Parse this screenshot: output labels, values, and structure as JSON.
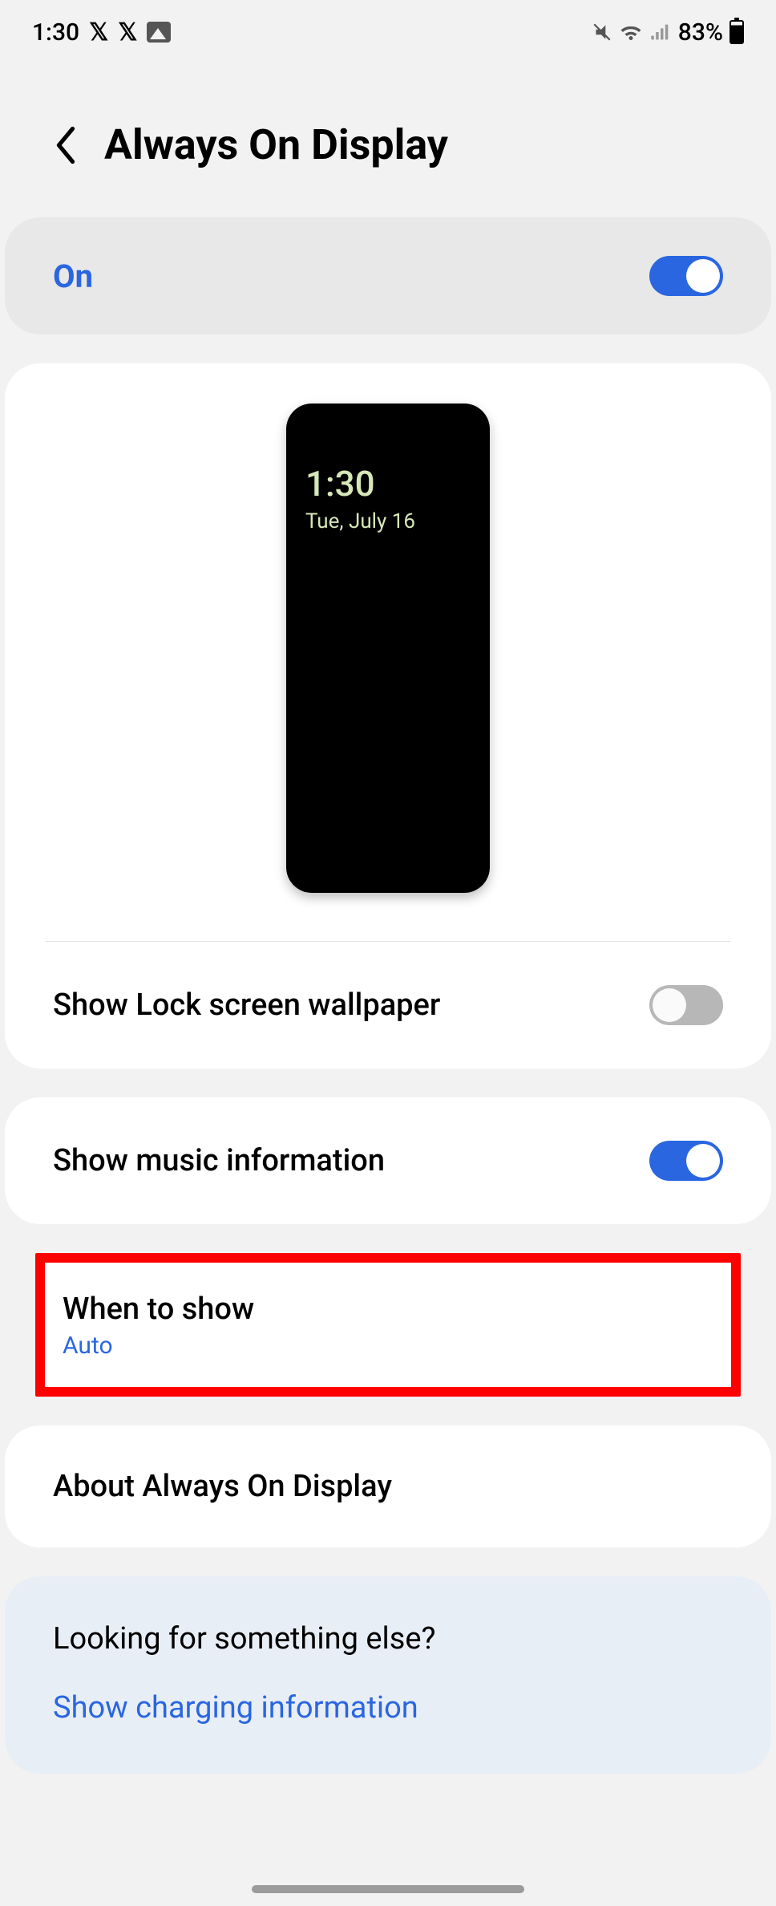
{
  "status": {
    "time": "1:30",
    "battery_pct": "83%"
  },
  "header": {
    "title": "Always On Display"
  },
  "master": {
    "label": "On",
    "enabled": true
  },
  "preview": {
    "time": "1:30",
    "date": "Tue, July 16"
  },
  "rows": {
    "show_wallpaper": {
      "title": "Show Lock screen wallpaper",
      "enabled": false
    },
    "show_music": {
      "title": "Show music information",
      "enabled": true
    },
    "when_to_show": {
      "title": "When to show",
      "value": "Auto"
    },
    "about": {
      "title": "About Always On Display"
    }
  },
  "looking": {
    "title": "Looking for something else?",
    "link": "Show charging information"
  }
}
